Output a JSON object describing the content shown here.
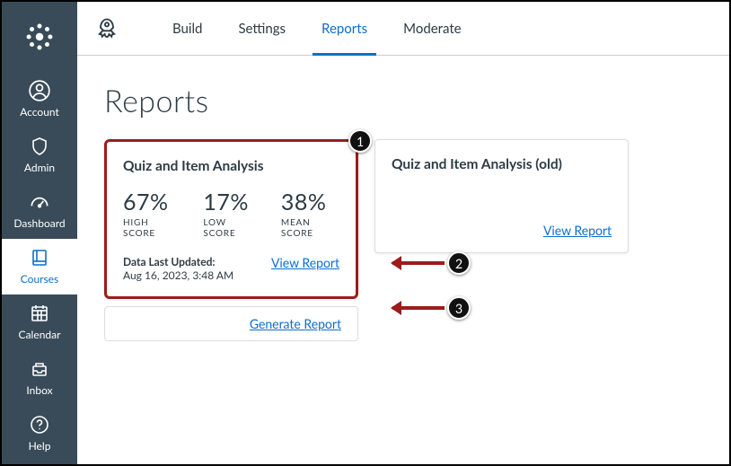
{
  "sidebar": {
    "items": [
      {
        "label": "Account"
      },
      {
        "label": "Admin"
      },
      {
        "label": "Dashboard"
      },
      {
        "label": "Courses"
      },
      {
        "label": "Calendar"
      },
      {
        "label": "Inbox"
      },
      {
        "label": "Help"
      }
    ]
  },
  "tabs": {
    "build": "Build",
    "settings": "Settings",
    "reports": "Reports",
    "moderate": "Moderate"
  },
  "page": {
    "title": "Reports"
  },
  "card1": {
    "title": "Quiz and Item Analysis",
    "high_val": "67%",
    "high_lab": "HIGH SCORE",
    "low_val": "17%",
    "low_lab": "LOW SCORE",
    "mean_val": "38%",
    "mean_lab": "MEAN SCORE",
    "updated_label": "Data Last Updated:",
    "updated_time": "Aug 16, 2023, 3:48 AM",
    "view": "View Report",
    "generate": "Generate Report"
  },
  "card2": {
    "title": "Quiz and Item Analysis (old)",
    "view": "View Report"
  },
  "annotations": {
    "b1": "1",
    "b2": "2",
    "b3": "3"
  }
}
